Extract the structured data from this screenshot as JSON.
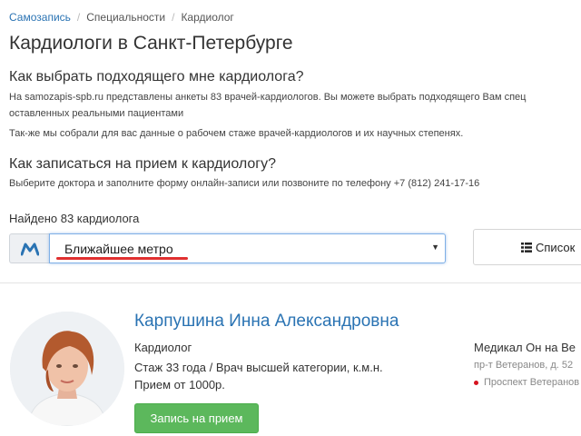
{
  "breadcrumb": {
    "items": [
      "Самозапись",
      "Специальности",
      "Кардиолог"
    ],
    "separator": "/"
  },
  "page_title": "Кардиологи в Санкт-Петербурге",
  "section_choose": {
    "heading": "Как выбрать подходящего мне кардиолога?",
    "line1": "На samozapis-spb.ru представлены анкеты 83 врачей-кардиологов. Вы можете выбрать подходящего Вам спец",
    "line2": "оставленных реальными пациентами",
    "line3": "Так-же мы собрали для вас данные о рабочем стаже врачей-кардиологов и их научных степенях."
  },
  "section_book": {
    "heading": "Как записаться на прием к кардиологу?",
    "line1": "Выберите доктора и заполните форму онлайн-записи или позвоните по телефону +7 (812) 241-17-16"
  },
  "found_count_text": "Найдено 83 кардиолога",
  "metro_filter": {
    "icon": "metro-logo-icon",
    "selected": "Ближайшее метро",
    "caret": "▼"
  },
  "list_button": {
    "icon": "list-icon",
    "label": "Список"
  },
  "doctor": {
    "name": "Карпушина Инна Александровна",
    "specialty": "Кардиолог",
    "experience": "Стаж 33 года / Врач высшей категории, к.м.н.",
    "price": "Прием от 1000р.",
    "book_label": "Запись на прием",
    "clinic_name": "Медикал Он на Ве",
    "clinic_address": "пр-т Ветеранов, д. 52",
    "clinic_metro": "Проспект Ветеранов (",
    "metro_line_color": "#d6131f"
  },
  "colors": {
    "link": "#2a73b3",
    "book_button": "#5cb85c",
    "highlight_underline": "#e03030"
  }
}
